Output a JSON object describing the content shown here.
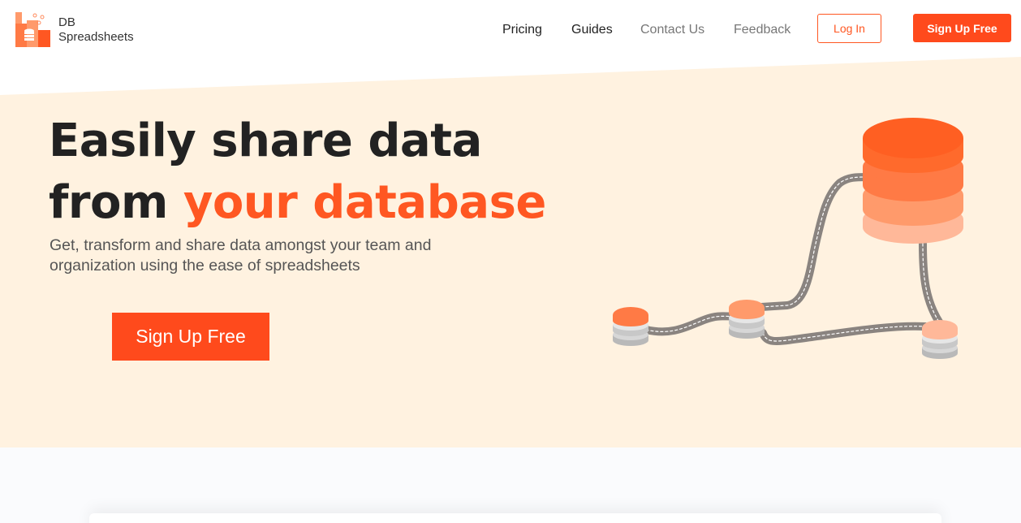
{
  "brand": {
    "line1": "DB",
    "line2": "Spreadsheets",
    "accent": "#ff5722"
  },
  "nav": [
    {
      "label": "Pricing"
    },
    {
      "label": "Guides"
    },
    {
      "label": "Contact Us"
    },
    {
      "label": "Feedback"
    }
  ],
  "auth": {
    "login_label": "Log In",
    "signup_label": "Sign Up Free"
  },
  "hero": {
    "headline_line1": "Easily share data",
    "headline_from": "from ",
    "headline_accent": "your database",
    "subtext": "Get, transform and share data amongst your team and organization using the ease of spreadsheets",
    "cta_label": "Sign Up Free",
    "background": "#fff2e0"
  },
  "illustration": {
    "icon": "database-network-illustration"
  }
}
